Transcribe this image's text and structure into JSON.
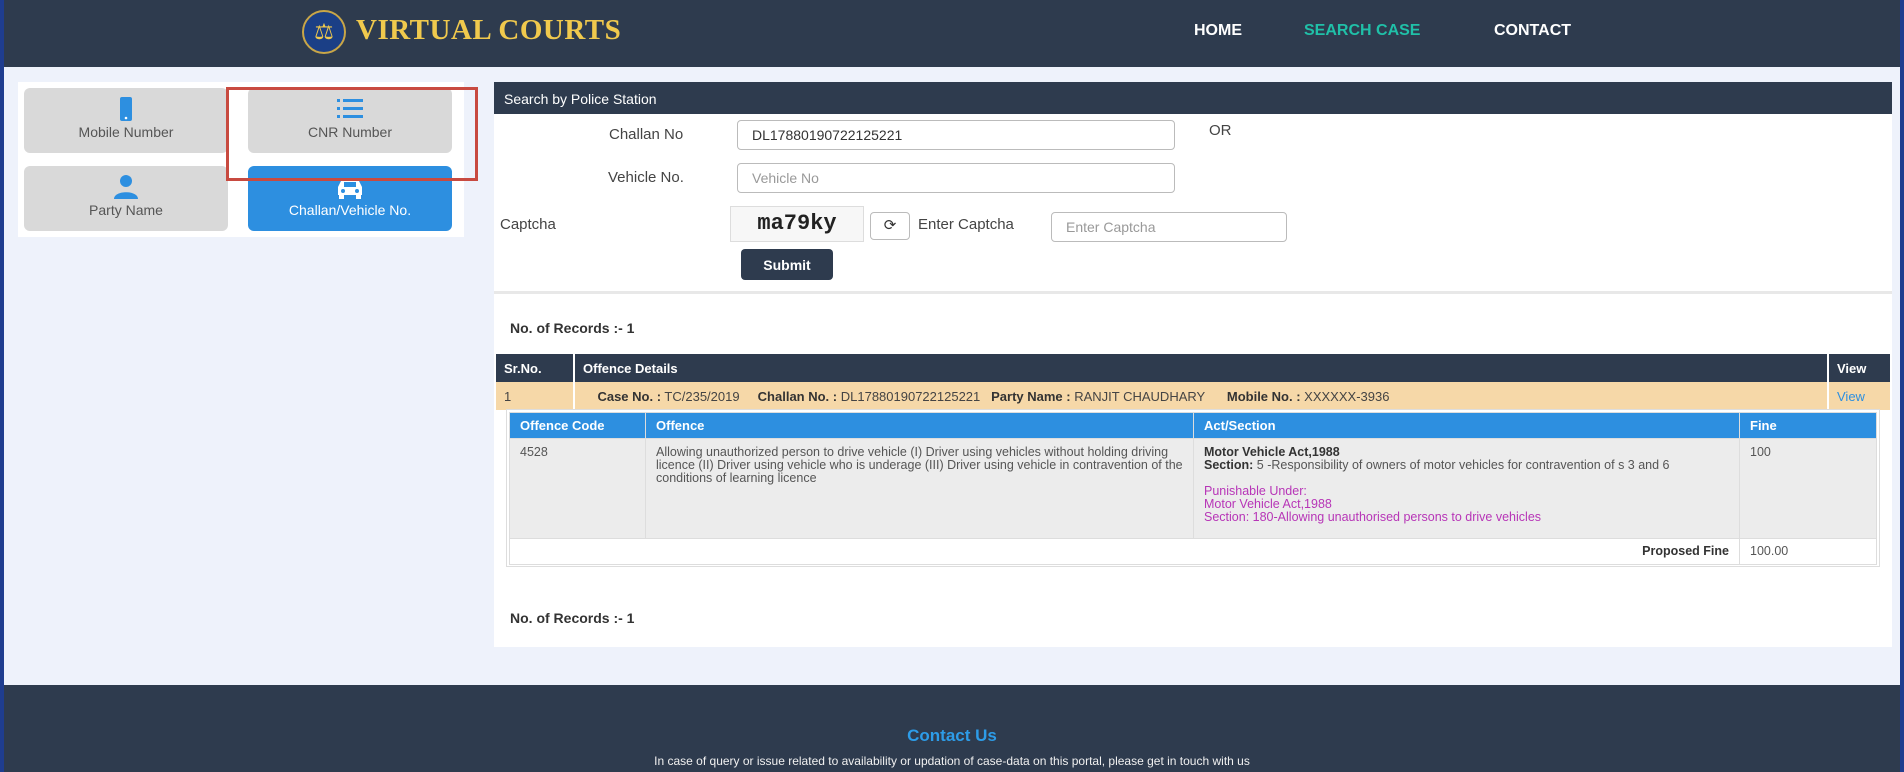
{
  "header": {
    "logo_text": "VIRTUAL COURTS",
    "nav": [
      {
        "label": "HOME"
      },
      {
        "label": "SEARCH CASE"
      },
      {
        "label": "CONTACT"
      }
    ]
  },
  "sidebar": {
    "tiles": [
      {
        "label": "Mobile Number",
        "icon": "mobile-icon"
      },
      {
        "label": "CNR Number",
        "icon": "list-icon"
      },
      {
        "label": "Party Name",
        "icon": "user-icon"
      },
      {
        "label": "Challan/Vehicle No.",
        "icon": "car-icon"
      }
    ]
  },
  "search": {
    "section_title": "Search by Police Station",
    "challan_label": "Challan No",
    "challan_value": "DL17880190722125221",
    "or_text": "OR",
    "vehicle_label": "Vehicle No.",
    "vehicle_placeholder": "Vehicle No",
    "captcha_label": "Captcha",
    "captcha_text": "ma79ky",
    "enter_captcha_label": "Enter Captcha",
    "enter_captcha_placeholder": "Enter Captcha",
    "submit_label": "Submit"
  },
  "records_text": "No. of Records :- 1",
  "results": {
    "headers": [
      "Sr.No.",
      "Offence Details",
      "View"
    ],
    "row": {
      "sr": "1",
      "case_no_label": "Case No. :",
      "case_no": "TC/235/2019",
      "challan_label": "Challan No. :",
      "challan_no": "DL17880190722125221",
      "party_label": "Party Name :",
      "party_name": "RANJIT CHAUDHARY",
      "mobile_label": "Mobile No. :",
      "mobile_no": "XXXXXX-3936",
      "view_label": "View"
    }
  },
  "details": {
    "headers": [
      "Offence Code",
      "Offence",
      "Act/Section",
      "Fine"
    ],
    "row": {
      "code": "4528",
      "offence": "Allowing unauthorized person to drive vehicle (I) Driver using vehicles without holding driving licence (II) Driver using vehicle who is underage (III) Driver using vehicle in contravention of the conditions of learning licence",
      "act": "Motor Vehicle Act,1988",
      "section_label": "Section:",
      "section": "5 -Responsibility of owners of motor vehicles for contravention of s 3 and 6",
      "punishable_label": "Punishable Under:",
      "punishable_act": "Motor Vehicle Act,1988",
      "punishable_section_label": "Section:",
      "punishable_section": "180-Allowing unauthorised persons to drive vehicles",
      "fine": "100"
    },
    "proposed_fine_label": "Proposed Fine",
    "proposed_fine": "100.00"
  },
  "footer": {
    "title": "Contact Us",
    "text": "In case of query or issue related to availability or updation of case-data on this portal, please get in touch with us"
  }
}
